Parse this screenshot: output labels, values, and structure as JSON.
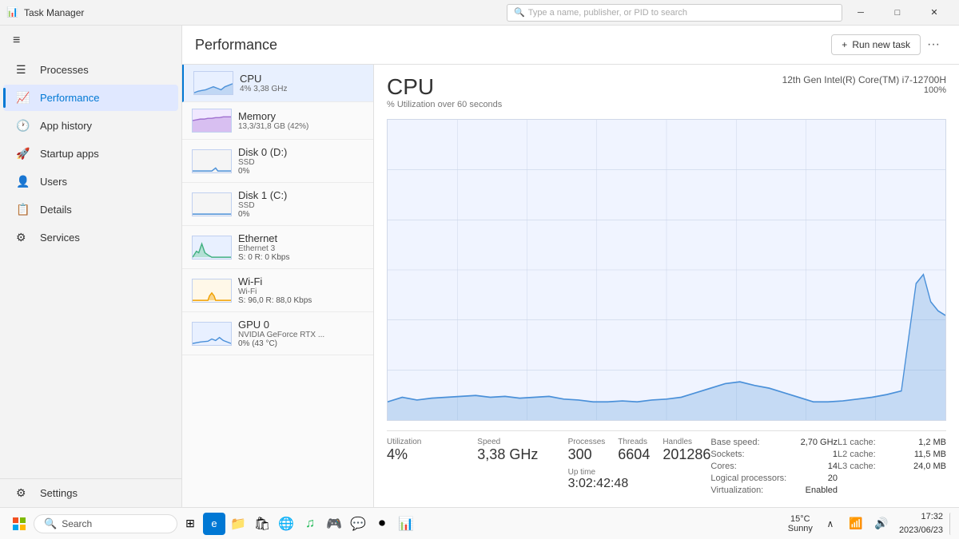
{
  "titlebar": {
    "title": "Task Manager",
    "search_placeholder": "Type a name, publisher, or PID to search",
    "min_label": "─",
    "max_label": "□",
    "close_label": "✕"
  },
  "header": {
    "title": "Performance",
    "run_task_label": "Run new task",
    "more_label": "···"
  },
  "sidebar": {
    "hamburger": "≡",
    "items": [
      {
        "id": "processes",
        "icon": "☰",
        "label": "Processes"
      },
      {
        "id": "performance",
        "icon": "📊",
        "label": "Performance"
      },
      {
        "id": "app-history",
        "icon": "🕐",
        "label": "App history"
      },
      {
        "id": "startup-apps",
        "icon": "🚀",
        "label": "Startup apps"
      },
      {
        "id": "users",
        "icon": "👤",
        "label": "Users"
      },
      {
        "id": "details",
        "icon": "📋",
        "label": "Details"
      },
      {
        "id": "services",
        "icon": "⚙",
        "label": "Services"
      }
    ],
    "settings_label": "Settings"
  },
  "resources": [
    {
      "id": "cpu",
      "name": "CPU",
      "sub": "4% 3,38 GHz",
      "type": "cpu"
    },
    {
      "id": "memory",
      "name": "Memory",
      "sub": "13,3/31,8 GB (42%)",
      "type": "memory"
    },
    {
      "id": "disk0",
      "name": "Disk 0 (D:)",
      "sub": "SSD",
      "usage": "0%",
      "type": "disk"
    },
    {
      "id": "disk1",
      "name": "Disk 1 (C:)",
      "sub": "SSD",
      "usage": "0%",
      "type": "disk"
    },
    {
      "id": "ethernet",
      "name": "Ethernet",
      "sub": "Ethernet 3",
      "usage": "S: 0  R: 0 Kbps",
      "type": "ethernet"
    },
    {
      "id": "wifi",
      "name": "Wi-Fi",
      "sub": "Wi-Fi",
      "usage": "S: 96,0  R: 88,0 Kbps",
      "type": "wifi"
    },
    {
      "id": "gpu0",
      "name": "GPU 0",
      "sub": "NVIDIA GeForce RTX ...",
      "usage": "0% (43 °C)",
      "type": "gpu"
    }
  ],
  "cpu_detail": {
    "title": "CPU",
    "model": "12th Gen Intel(R) Core(TM) i7-12700H",
    "subtitle": "% Utilization over 60 seconds",
    "percent_label": "100%",
    "stats": {
      "utilization_label": "Utilization",
      "utilization_value": "4%",
      "speed_label": "Speed",
      "speed_value": "3,38 GHz",
      "processes_label": "Processes",
      "processes_value": "300",
      "threads_label": "Threads",
      "threads_value": "6604",
      "handles_label": "Handles",
      "handles_value": "201286",
      "uptime_label": "Up time",
      "uptime_value": "3:02:42:48"
    },
    "specs": {
      "base_speed_label": "Base speed:",
      "base_speed_value": "2,70 GHz",
      "sockets_label": "Sockets:",
      "sockets_value": "1",
      "cores_label": "Cores:",
      "cores_value": "14",
      "logical_label": "Logical processors:",
      "logical_value": "20",
      "virtualization_label": "Virtualization:",
      "virtualization_value": "Enabled",
      "l1_label": "L1 cache:",
      "l1_value": "1,2 MB",
      "l2_label": "L2 cache:",
      "l2_value": "11,5 MB",
      "l3_label": "L3 cache:",
      "l3_value": "24,0 MB"
    }
  },
  "taskbar": {
    "search_placeholder": "Search",
    "time": "17:32",
    "date": "2023/06/23",
    "weather_temp": "15°C",
    "weather_desc": "Sunny"
  }
}
